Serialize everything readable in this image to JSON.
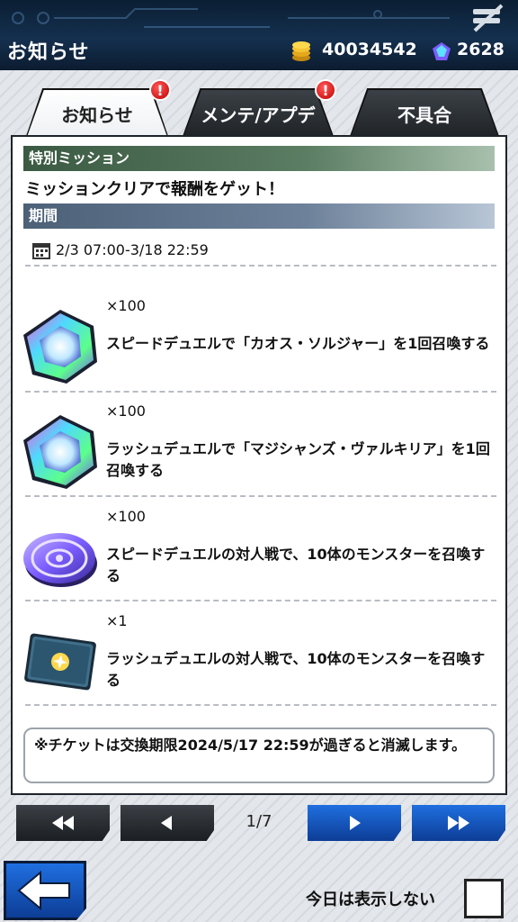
{
  "header": {
    "title": "お知らせ",
    "coins": "40034542",
    "gems": "2628"
  },
  "tabs": [
    {
      "label": "お知らせ",
      "active": true,
      "alert": "!"
    },
    {
      "label": "メンテ/アプデ",
      "active": false,
      "alert": "!"
    },
    {
      "label": "不具合",
      "active": false
    }
  ],
  "notice": {
    "section_title": "特別ミッション",
    "subtitle": "ミッションクリアで報酬をゲット！",
    "period_header": "期間",
    "period": "2/3 07:00-3/18 22:59",
    "missions": [
      {
        "icon": "rainbow-gem-icon",
        "qty": "×100",
        "desc": "スピードデュエルで「カオス・ソルジャー」を1回召喚する"
      },
      {
        "icon": "rainbow-gem-icon",
        "qty": "×100",
        "desc": "ラッシュデュエルで「マジシャンズ・ヴァルキリア」を1回召喚する"
      },
      {
        "icon": "purple-medal-icon",
        "qty": "×100",
        "desc": "スピードデュエルの対人戦で、10体のモンスターを召喚する"
      },
      {
        "icon": "ticket-icon",
        "qty": "×1",
        "desc": "ラッシュデュエルの対人戦で、10体のモンスターを召喚する"
      }
    ],
    "note": "※チケットは交換期限2024/5/17 22:59が過ぎると消滅します。"
  },
  "pager": {
    "page": "1/7"
  },
  "footer": {
    "dont_show_label": "今日は表示しない"
  },
  "colors": {
    "accent_blue": "#1f6fe0",
    "alert_red": "#d40000",
    "header_dark": "#0b1e33"
  }
}
